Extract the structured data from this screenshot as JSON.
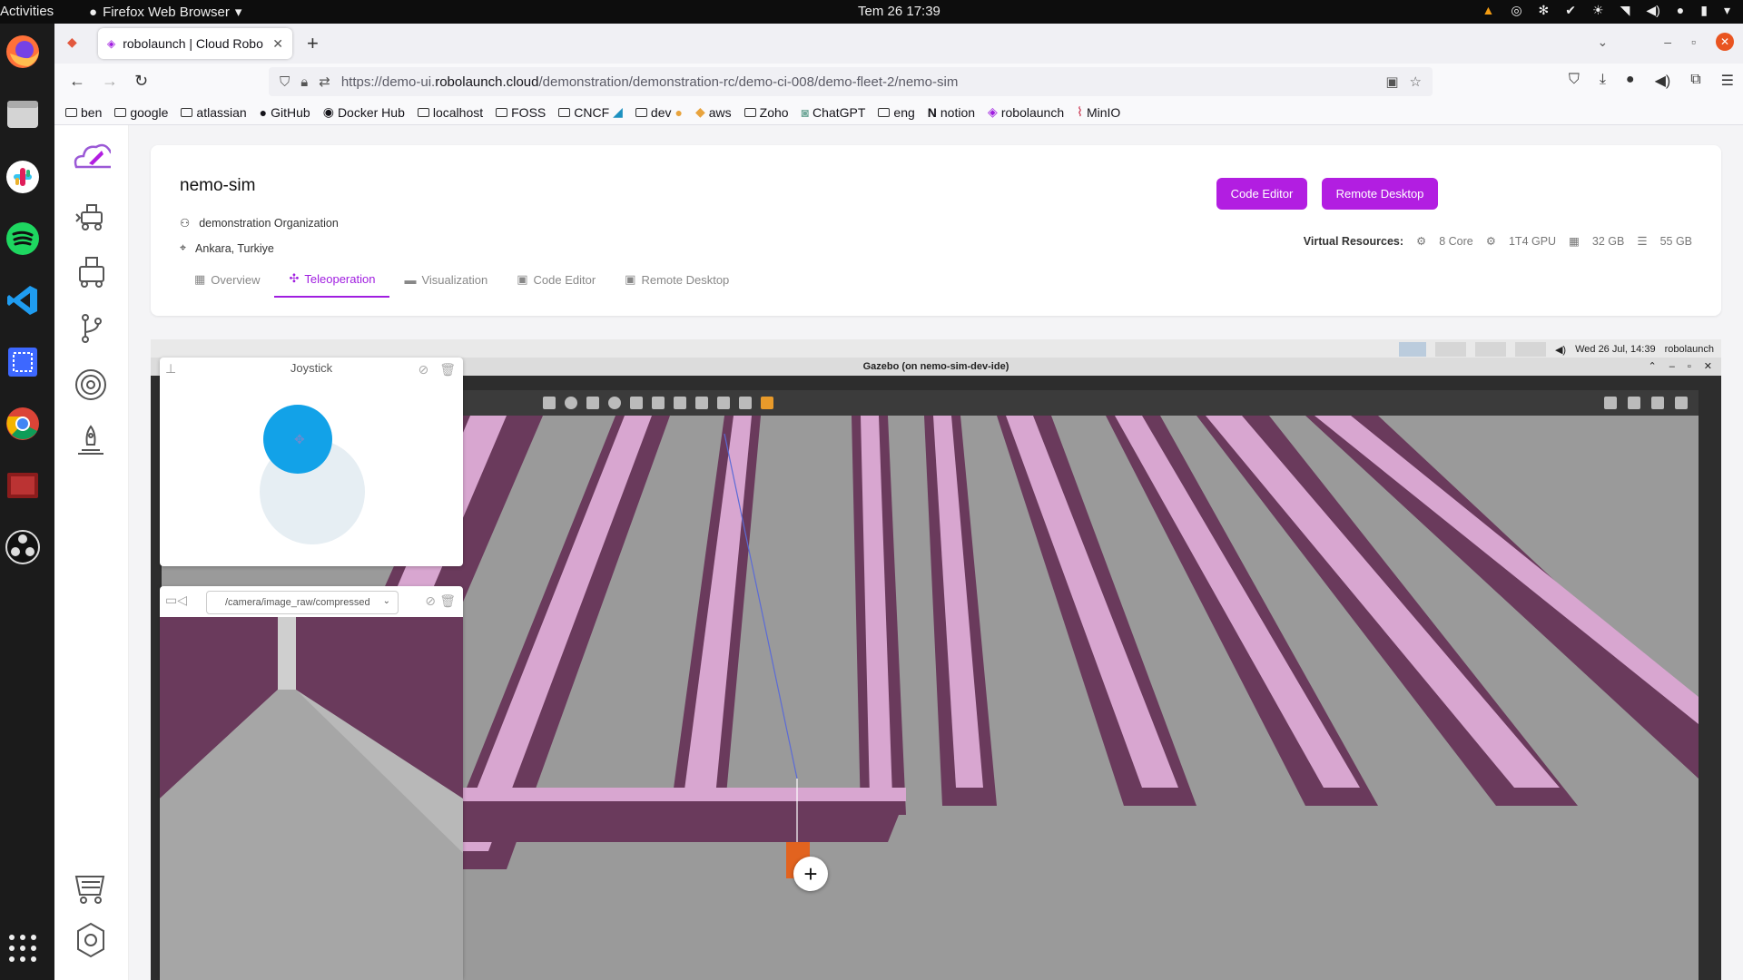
{
  "topbar": {
    "activities": "Activities",
    "app_name": "Firefox Web Browser",
    "clock": "Tem 26  17:39"
  },
  "browser": {
    "tab_title": "robolaunch | Cloud Robo",
    "url_prefix": "https://demo-ui.",
    "url_domain": "robolaunch.cloud",
    "url_path": "/demonstration/demonstration-rc/demo-ci-008/demo-fleet-2/nemo-sim",
    "bookmarks": [
      "ben",
      "google",
      "atlassian",
      "GitHub",
      "Docker Hub",
      "localhost",
      "FOSS",
      "CNCF",
      "dev",
      "aws",
      "Zoho",
      "ChatGPT",
      "eng",
      "notion",
      "robolaunch",
      "MinIO"
    ]
  },
  "header": {
    "title": "nemo-sim",
    "organization": "demonstration Organization",
    "location": "Ankara, Turkiye",
    "code_editor_button": "Code Editor",
    "remote_desktop_button": "Remote Desktop",
    "virtual_resources_label": "Virtual Resources:",
    "cpu": "8 Core",
    "gpu": "1T4 GPU",
    "memory": "32 GB",
    "storage": "55 GB",
    "accent_color": "#b21ee1"
  },
  "tabs": [
    {
      "label": "Overview",
      "active": false
    },
    {
      "label": "Teleoperation",
      "active": true
    },
    {
      "label": "Visualization",
      "active": false
    },
    {
      "label": "Code Editor",
      "active": false
    },
    {
      "label": "Remote Desktop",
      "active": false
    }
  ],
  "remote": {
    "panel_clock": "Wed 26 Jul, 14:39",
    "panel_user": "robolaunch",
    "gazebo_title": "Gazebo (on nemo-sim-dev-ide)"
  },
  "widgets": {
    "joystick_title": "Joystick",
    "camera_topic": "/camera/image_raw/compressed"
  }
}
